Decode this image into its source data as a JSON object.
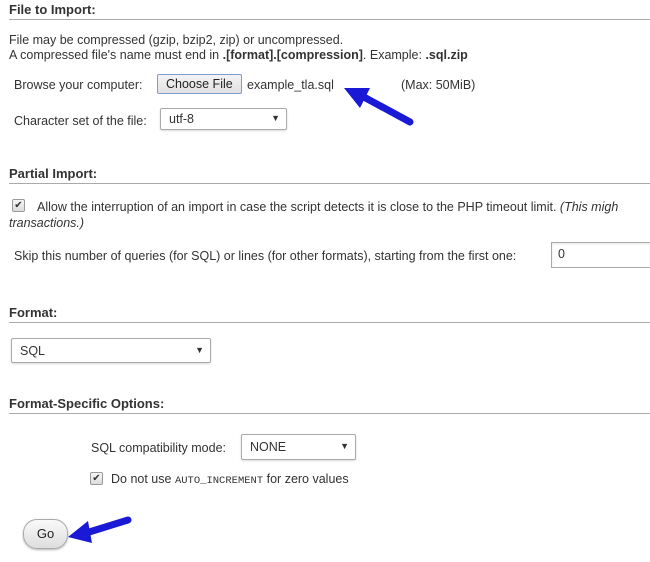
{
  "file_import": {
    "title": "File to Import:",
    "line1": "File may be compressed (gzip, bzip2, zip) or uncompressed.",
    "line2_prefix": "A compressed file's name must end in ",
    "line2_bold": ".[format].[compression]",
    "line2_mid": ". Example: ",
    "line2_example": ".sql.zip",
    "browse_label": "Browse your computer:",
    "choose_file_button": "Choose File",
    "selected_file": "example_tla.sql",
    "max_size": "(Max: 50MiB)",
    "charset_label": "Character set of the file:",
    "charset_value": "utf-8"
  },
  "partial_import": {
    "title": "Partial Import:",
    "allow_interrupt_checked": true,
    "allow_interrupt_label": "Allow the interruption of an import in case the script detects it is close to the PHP timeout limit. ",
    "allow_interrupt_note_start": "(This migh",
    "allow_interrupt_note_end": "transactions.)",
    "skip_label": "Skip this number of queries (for SQL) or lines (for other formats), starting from the first one:",
    "skip_value": "0"
  },
  "format": {
    "title": "Format:",
    "value": "SQL"
  },
  "format_options": {
    "title": "Format-Specific Options:",
    "compat_label": "SQL compatibility mode:",
    "compat_value": "NONE",
    "auto_increment_checked": true,
    "auto_inc_prefix": "Do not use ",
    "auto_inc_code": "AUTO_INCREMENT",
    "auto_inc_suffix": " for zero values"
  },
  "go_button": "Go",
  "icons": {
    "dropdown": "▼",
    "check": "✔"
  },
  "colors": {
    "annotation_arrow": "#1a1ad6"
  }
}
